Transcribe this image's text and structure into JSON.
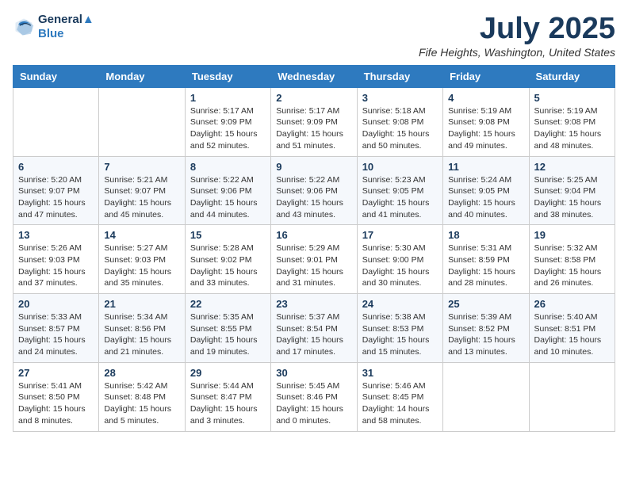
{
  "logo": {
    "line1": "General",
    "line2": "Blue"
  },
  "title": "July 2025",
  "location": "Fife Heights, Washington, United States",
  "days_of_week": [
    "Sunday",
    "Monday",
    "Tuesday",
    "Wednesday",
    "Thursday",
    "Friday",
    "Saturday"
  ],
  "weeks": [
    [
      {
        "day": "",
        "detail": ""
      },
      {
        "day": "",
        "detail": ""
      },
      {
        "day": "1",
        "detail": "Sunrise: 5:17 AM\nSunset: 9:09 PM\nDaylight: 15 hours\nand 52 minutes."
      },
      {
        "day": "2",
        "detail": "Sunrise: 5:17 AM\nSunset: 9:09 PM\nDaylight: 15 hours\nand 51 minutes."
      },
      {
        "day": "3",
        "detail": "Sunrise: 5:18 AM\nSunset: 9:08 PM\nDaylight: 15 hours\nand 50 minutes."
      },
      {
        "day": "4",
        "detail": "Sunrise: 5:19 AM\nSunset: 9:08 PM\nDaylight: 15 hours\nand 49 minutes."
      },
      {
        "day": "5",
        "detail": "Sunrise: 5:19 AM\nSunset: 9:08 PM\nDaylight: 15 hours\nand 48 minutes."
      }
    ],
    [
      {
        "day": "6",
        "detail": "Sunrise: 5:20 AM\nSunset: 9:07 PM\nDaylight: 15 hours\nand 47 minutes."
      },
      {
        "day": "7",
        "detail": "Sunrise: 5:21 AM\nSunset: 9:07 PM\nDaylight: 15 hours\nand 45 minutes."
      },
      {
        "day": "8",
        "detail": "Sunrise: 5:22 AM\nSunset: 9:06 PM\nDaylight: 15 hours\nand 44 minutes."
      },
      {
        "day": "9",
        "detail": "Sunrise: 5:22 AM\nSunset: 9:06 PM\nDaylight: 15 hours\nand 43 minutes."
      },
      {
        "day": "10",
        "detail": "Sunrise: 5:23 AM\nSunset: 9:05 PM\nDaylight: 15 hours\nand 41 minutes."
      },
      {
        "day": "11",
        "detail": "Sunrise: 5:24 AM\nSunset: 9:05 PM\nDaylight: 15 hours\nand 40 minutes."
      },
      {
        "day": "12",
        "detail": "Sunrise: 5:25 AM\nSunset: 9:04 PM\nDaylight: 15 hours\nand 38 minutes."
      }
    ],
    [
      {
        "day": "13",
        "detail": "Sunrise: 5:26 AM\nSunset: 9:03 PM\nDaylight: 15 hours\nand 37 minutes."
      },
      {
        "day": "14",
        "detail": "Sunrise: 5:27 AM\nSunset: 9:03 PM\nDaylight: 15 hours\nand 35 minutes."
      },
      {
        "day": "15",
        "detail": "Sunrise: 5:28 AM\nSunset: 9:02 PM\nDaylight: 15 hours\nand 33 minutes."
      },
      {
        "day": "16",
        "detail": "Sunrise: 5:29 AM\nSunset: 9:01 PM\nDaylight: 15 hours\nand 31 minutes."
      },
      {
        "day": "17",
        "detail": "Sunrise: 5:30 AM\nSunset: 9:00 PM\nDaylight: 15 hours\nand 30 minutes."
      },
      {
        "day": "18",
        "detail": "Sunrise: 5:31 AM\nSunset: 8:59 PM\nDaylight: 15 hours\nand 28 minutes."
      },
      {
        "day": "19",
        "detail": "Sunrise: 5:32 AM\nSunset: 8:58 PM\nDaylight: 15 hours\nand 26 minutes."
      }
    ],
    [
      {
        "day": "20",
        "detail": "Sunrise: 5:33 AM\nSunset: 8:57 PM\nDaylight: 15 hours\nand 24 minutes."
      },
      {
        "day": "21",
        "detail": "Sunrise: 5:34 AM\nSunset: 8:56 PM\nDaylight: 15 hours\nand 21 minutes."
      },
      {
        "day": "22",
        "detail": "Sunrise: 5:35 AM\nSunset: 8:55 PM\nDaylight: 15 hours\nand 19 minutes."
      },
      {
        "day": "23",
        "detail": "Sunrise: 5:37 AM\nSunset: 8:54 PM\nDaylight: 15 hours\nand 17 minutes."
      },
      {
        "day": "24",
        "detail": "Sunrise: 5:38 AM\nSunset: 8:53 PM\nDaylight: 15 hours\nand 15 minutes."
      },
      {
        "day": "25",
        "detail": "Sunrise: 5:39 AM\nSunset: 8:52 PM\nDaylight: 15 hours\nand 13 minutes."
      },
      {
        "day": "26",
        "detail": "Sunrise: 5:40 AM\nSunset: 8:51 PM\nDaylight: 15 hours\nand 10 minutes."
      }
    ],
    [
      {
        "day": "27",
        "detail": "Sunrise: 5:41 AM\nSunset: 8:50 PM\nDaylight: 15 hours\nand 8 minutes."
      },
      {
        "day": "28",
        "detail": "Sunrise: 5:42 AM\nSunset: 8:48 PM\nDaylight: 15 hours\nand 5 minutes."
      },
      {
        "day": "29",
        "detail": "Sunrise: 5:44 AM\nSunset: 8:47 PM\nDaylight: 15 hours\nand 3 minutes."
      },
      {
        "day": "30",
        "detail": "Sunrise: 5:45 AM\nSunset: 8:46 PM\nDaylight: 15 hours\nand 0 minutes."
      },
      {
        "day": "31",
        "detail": "Sunrise: 5:46 AM\nSunset: 8:45 PM\nDaylight: 14 hours\nand 58 minutes."
      },
      {
        "day": "",
        "detail": ""
      },
      {
        "day": "",
        "detail": ""
      }
    ]
  ]
}
